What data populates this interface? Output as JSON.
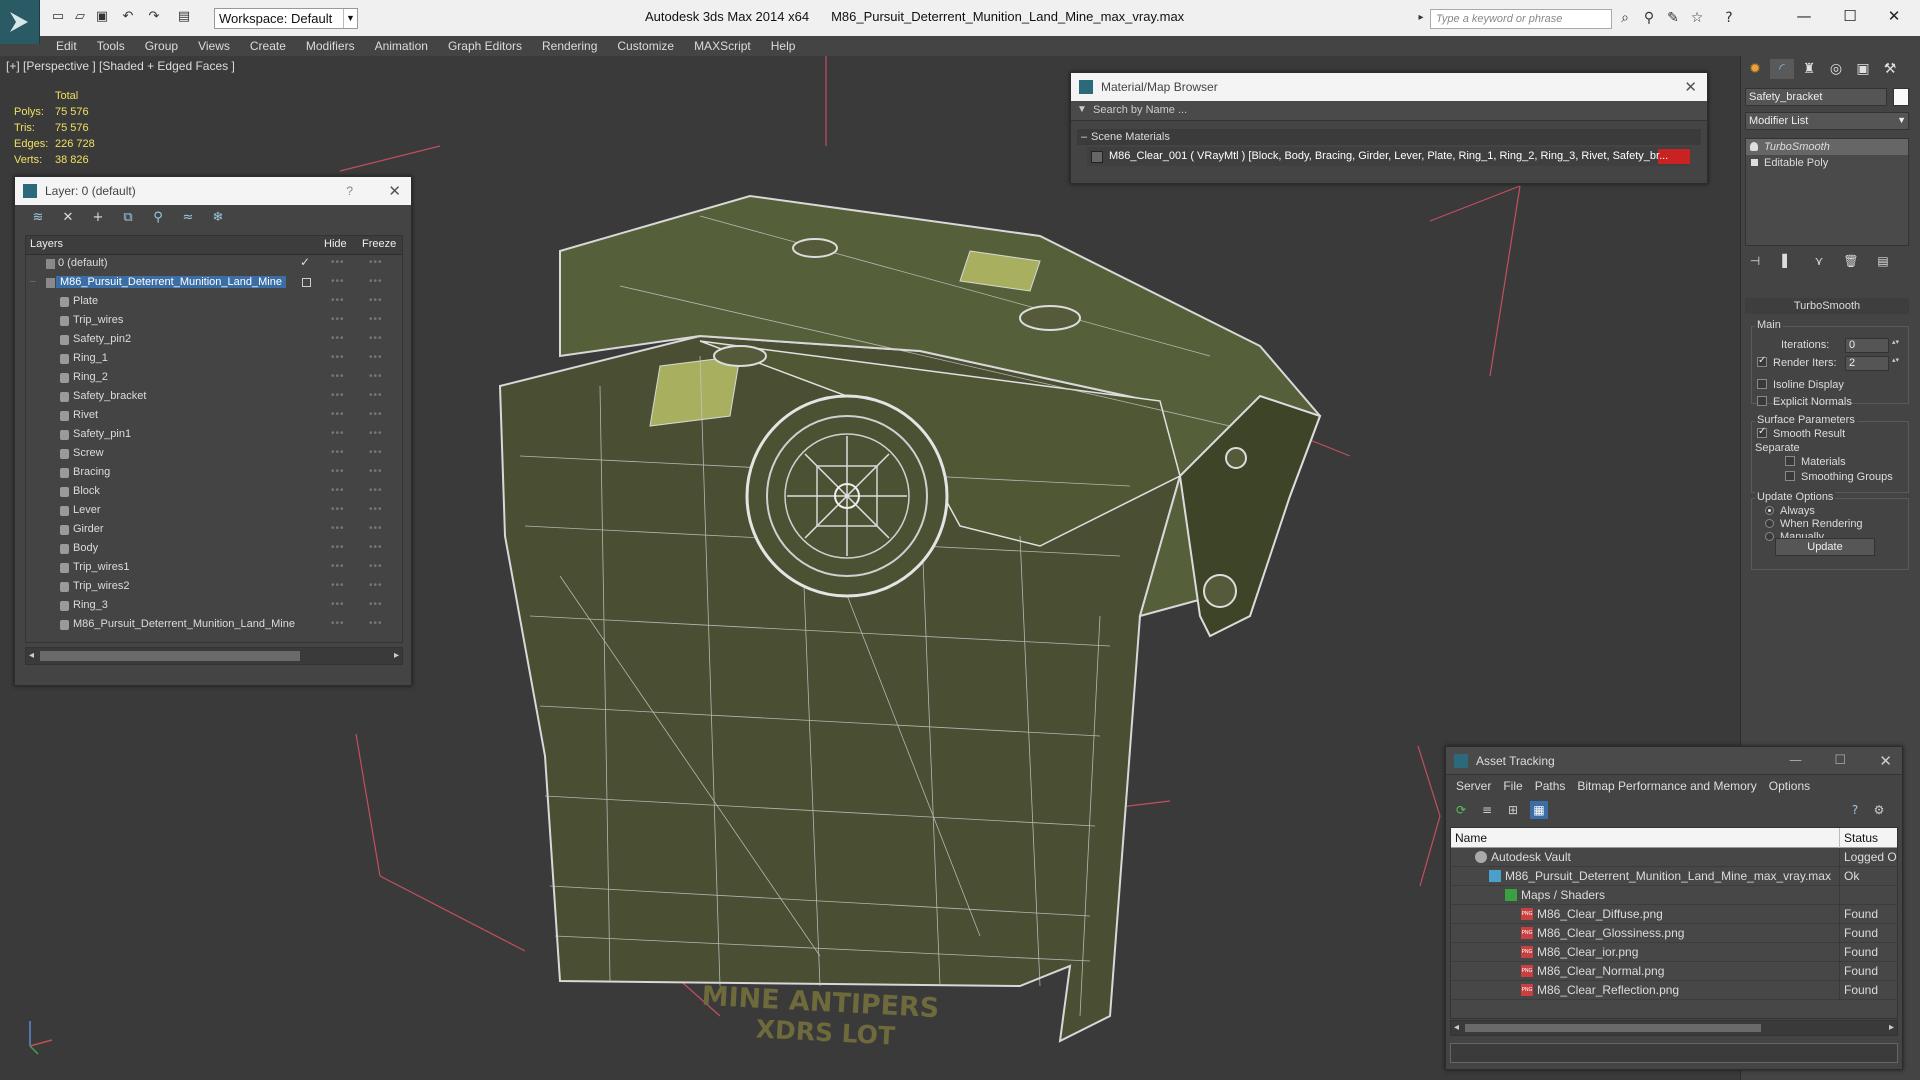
{
  "titlebar": {
    "workspace": "Workspace: Default",
    "app_name": "Autodesk 3ds Max  2014 x64",
    "file_name": "M86_Pursuit_Deterrent_Munition_Land_Mine_max_vray.max",
    "search_placeholder": "Type a keyword or phrase"
  },
  "menu": [
    "Edit",
    "Tools",
    "Group",
    "Views",
    "Create",
    "Modifiers",
    "Animation",
    "Graph Editors",
    "Rendering",
    "Customize",
    "MAXScript",
    "Help"
  ],
  "viewport": {
    "label": "[+] [Perspective ] [Shaded + Edged Faces ]",
    "stats": {
      "total_label": "Total",
      "rows": [
        {
          "label": "Polys:",
          "value": "75 576"
        },
        {
          "label": "Tris:",
          "value": "75 576"
        },
        {
          "label": "Edges:",
          "value": "226 728"
        },
        {
          "label": "Verts:",
          "value": "38 826"
        }
      ]
    },
    "decal_line1": "MINE ANTIPERS",
    "decal_line2": "XDRS LOT"
  },
  "layer_panel": {
    "title": "Layer: 0 (default)",
    "help": "?",
    "col_layers": "Layers",
    "col_hide": "Hide",
    "col_freeze": "Freeze",
    "default_layer": "0 (default)",
    "selected_layer": "M86_Pursuit_Deterrent_Munition_Land_Mine",
    "objects": [
      "Plate",
      "Trip_wires",
      "Safety_pin2",
      "Ring_1",
      "Ring_2",
      "Safety_bracket",
      "Rivet",
      "Safety_pin1",
      "Screw",
      "Bracing",
      "Block",
      "Lever",
      "Girder",
      "Body",
      "Trip_wires1",
      "Trip_wires2",
      "Ring_3",
      "M86_Pursuit_Deterrent_Munition_Land_Mine"
    ]
  },
  "material_browser": {
    "title": "Material/Map Browser",
    "search_placeholder": "Search by Name ...",
    "section": "Scene Materials",
    "item": "M86_Clear_001  ( VRayMtl )  [Block, Body, Bracing, Girder, Lever, Plate, Ring_1, Ring_2, Ring_3, Rivet, Safety_br..."
  },
  "command_panel": {
    "object_name": "Safety_bracket",
    "modifier_list": "Modifier List",
    "stack": [
      "TurboSmooth",
      "Editable Poly"
    ],
    "rollout": "TurboSmooth",
    "main_label": "Main",
    "iterations_label": "Iterations:",
    "iterations_value": "0",
    "render_iters_label": "Render Iters:",
    "render_iters_value": "2",
    "isoline_label": "Isoline Display",
    "explicit_label": "Explicit Normals",
    "surface_label": "Surface Parameters",
    "smooth_result_label": "Smooth Result",
    "separate_label": "Separate",
    "materials_label": "Materials",
    "smoothing_groups_label": "Smoothing Groups",
    "update_options_label": "Update Options",
    "always_label": "Always",
    "when_rendering_label": "When Rendering",
    "manually_label": "Manually",
    "update_button": "Update"
  },
  "asset_tracking": {
    "title": "Asset Tracking",
    "menu": [
      "Server",
      "File",
      "Paths",
      "Bitmap Performance and Memory",
      "Options"
    ],
    "col_name": "Name",
    "col_status": "Status",
    "rows": [
      {
        "name": "Autodesk Vault",
        "status": "Logged O"
      },
      {
        "name": "M86_Pursuit_Deterrent_Munition_Land_Mine_max_vray.max",
        "status": "Ok"
      },
      {
        "name": "Maps / Shaders",
        "status": ""
      },
      {
        "name": "M86_Clear_Diffuse.png",
        "status": "Found"
      },
      {
        "name": "M86_Clear_Glossiness.png",
        "status": "Found"
      },
      {
        "name": "M86_Clear_ior.png",
        "status": "Found"
      },
      {
        "name": "M86_Clear_Normal.png",
        "status": "Found"
      },
      {
        "name": "M86_Clear_Reflection.png",
        "status": "Found"
      }
    ]
  }
}
